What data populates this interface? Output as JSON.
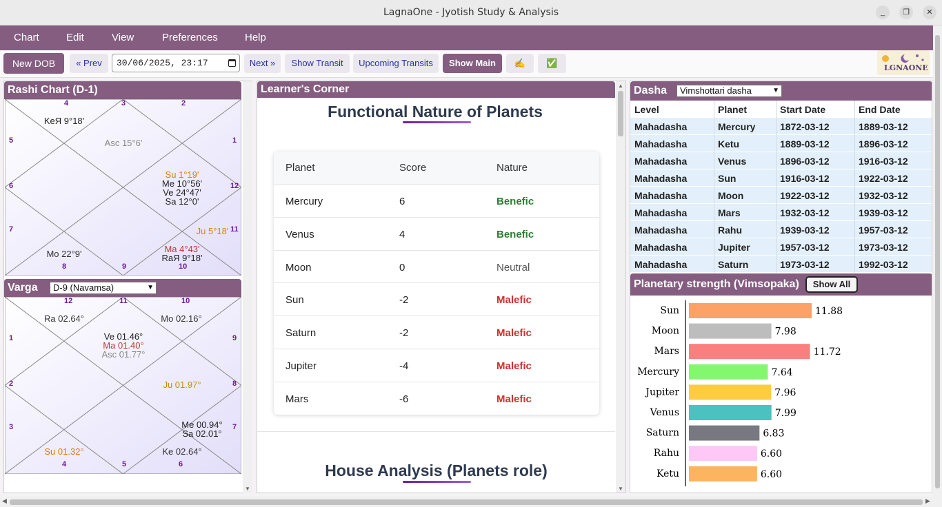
{
  "window": {
    "title": "LagnaOne - Jyotish Study & Analysis",
    "minimize_icon": "_",
    "maximize_icon": "❐",
    "close_icon": "✕"
  },
  "menu": [
    "Chart",
    "Edit",
    "View",
    "Preferences",
    "Help"
  ],
  "toolbar": {
    "new_dob": "New DOB",
    "prev": "« Prev",
    "datetime": "30/06/2025, 23:17",
    "next": "Next »",
    "show_transit": "Show Transit",
    "upcoming_transits": "Upcoming Transits",
    "show_main": "Show Main",
    "pen_icon": "✍",
    "check_icon": "✅",
    "logo_text": "LGNAONE"
  },
  "rashi": {
    "title": "Rashi Chart (D-1)",
    "house_numbers": [
      "4",
      "3",
      "2",
      "5",
      "1",
      "6",
      "12",
      "7",
      "11",
      "8",
      "9",
      "10"
    ],
    "planets": [
      {
        "text": "KeЯ 9°18'",
        "color": "#222"
      },
      {
        "text": "Asc 15°6'",
        "color": "#888"
      },
      {
        "text": "Su 1°19'",
        "color": "#e07b00"
      },
      {
        "text": "Me 10°56'",
        "color": "#222"
      },
      {
        "text": "Ve 24°47'",
        "color": "#222"
      },
      {
        "text": "Sa 12°0'",
        "color": "#222"
      },
      {
        "text": "Ju 5°18'",
        "color": "#d08a00"
      },
      {
        "text": "Mo 22°9'",
        "color": "#333"
      },
      {
        "text": "Ma 4°43'",
        "color": "#c0392b"
      },
      {
        "text": "RaЯ 9°18'",
        "color": "#222"
      }
    ]
  },
  "varga": {
    "title": "Varga",
    "selected": "D-9 (Navamsa)",
    "house_numbers": [
      "12",
      "11",
      "10",
      "1",
      "9",
      "2",
      "8",
      "3",
      "7",
      "4",
      "5",
      "6"
    ],
    "planets": [
      {
        "text": "Ra 02.64°",
        "color": "#333"
      },
      {
        "text": "Mo 02.16°",
        "color": "#333"
      },
      {
        "text": "Ve 01.46°",
        "color": "#222"
      },
      {
        "text": "Ma 01.40°",
        "color": "#c0392b"
      },
      {
        "text": "Asc 01.77°",
        "color": "#888"
      },
      {
        "text": "Ju 01.97°",
        "color": "#d08a00"
      },
      {
        "text": "Me 00.94°",
        "color": "#222"
      },
      {
        "text": "Sa 02.01°",
        "color": "#222"
      },
      {
        "text": "Su 01.32°",
        "color": "#e07b00"
      },
      {
        "text": "Ke 02.64°",
        "color": "#333"
      }
    ]
  },
  "learners": {
    "title": "Learner's Corner",
    "section1": "Functional Nature of Planets",
    "headers": [
      "Planet",
      "Score",
      "Nature"
    ],
    "rows": [
      {
        "planet": "Mercury",
        "score": "6",
        "nature": "Benefic"
      },
      {
        "planet": "Venus",
        "score": "4",
        "nature": "Benefic"
      },
      {
        "planet": "Moon",
        "score": "0",
        "nature": "Neutral"
      },
      {
        "planet": "Sun",
        "score": "-2",
        "nature": "Malefic"
      },
      {
        "planet": "Saturn",
        "score": "-2",
        "nature": "Malefic"
      },
      {
        "planet": "Jupiter",
        "score": "-4",
        "nature": "Malefic"
      },
      {
        "planet": "Mars",
        "score": "-6",
        "nature": "Malefic"
      }
    ],
    "section2": "House Analysis (Planets role)"
  },
  "dasha": {
    "title": "Dasha",
    "selected": "Vimshottari dasha",
    "headers": [
      "Level",
      "Planet",
      "Start Date",
      "End Date"
    ],
    "rows": [
      [
        "Mahadasha",
        "Mercury",
        "1872-03-12",
        "1889-03-12"
      ],
      [
        "Mahadasha",
        "Ketu",
        "1889-03-12",
        "1896-03-12"
      ],
      [
        "Mahadasha",
        "Venus",
        "1896-03-12",
        "1916-03-12"
      ],
      [
        "Mahadasha",
        "Sun",
        "1916-03-12",
        "1922-03-12"
      ],
      [
        "Mahadasha",
        "Moon",
        "1922-03-12",
        "1932-03-12"
      ],
      [
        "Mahadasha",
        "Mars",
        "1932-03-12",
        "1939-03-12"
      ],
      [
        "Mahadasha",
        "Rahu",
        "1939-03-12",
        "1957-03-12"
      ],
      [
        "Mahadasha",
        "Jupiter",
        "1957-03-12",
        "1973-03-12"
      ],
      [
        "Mahadasha",
        "Saturn",
        "1973-03-12",
        "1992-03-12"
      ]
    ]
  },
  "strength": {
    "title": "Planetary strength (Vimsopaka)",
    "show_all": "Show All"
  },
  "chart_data": {
    "type": "bar",
    "orientation": "horizontal",
    "categories": [
      "Sun",
      "Moon",
      "Mars",
      "Mercury",
      "Jupiter",
      "Venus",
      "Saturn",
      "Rahu",
      "Ketu"
    ],
    "values": [
      11.88,
      7.98,
      11.72,
      7.64,
      7.96,
      7.99,
      6.83,
      6.6,
      6.6
    ],
    "labels": [
      "11.88",
      "7.98",
      "11.72",
      "7.64",
      "7.96",
      "7.99",
      "6.83",
      "6.60",
      "6.60"
    ],
    "colors": [
      "#fca266",
      "#bdbdbd",
      "#fb7f7f",
      "#83f86f",
      "#fdcd3f",
      "#4bc2bf",
      "#777880",
      "#fdc8f6",
      "#fcb45e"
    ],
    "xlim": [
      0,
      20
    ],
    "grid": false
  }
}
